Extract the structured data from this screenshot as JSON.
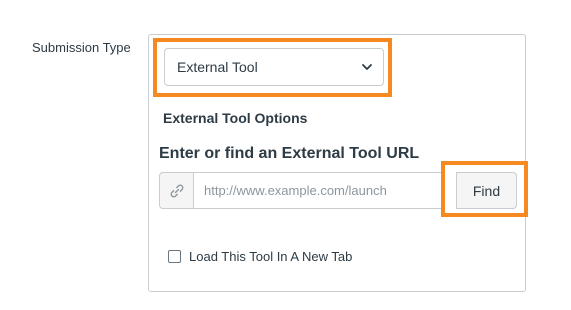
{
  "form": {
    "submission_type_label": "Submission Type",
    "submission_type_value": "External Tool",
    "options_heading": "External Tool Options",
    "url_heading": "Enter or find an External Tool URL",
    "url_placeholder": "http://www.example.com/launch",
    "url_value": "",
    "find_button_label": "Find",
    "new_tab_checkbox_label": "Load This Tool In A New Tab",
    "new_tab_checked": false
  },
  "icons": {
    "select_chevron": "chevron-down-icon",
    "url_addon": "link-icon"
  },
  "colors": {
    "highlight": "#f6891f",
    "border": "#c7cdd1",
    "text": "#2d3b45"
  }
}
